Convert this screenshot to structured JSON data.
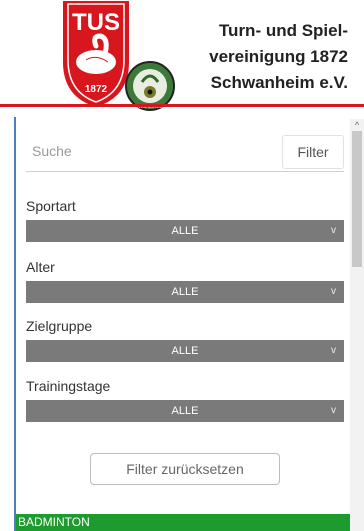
{
  "header": {
    "logo": {
      "tus_text": "TUS",
      "year": "1872",
      "badge_text": "SCHÜTZEN SCHWANHEIM"
    },
    "club_name_lines": [
      "Turn- und Spiel-",
      "vereinigung 1872",
      "Schwanheim e.V."
    ]
  },
  "search": {
    "placeholder": "Suche",
    "filter_button": "Filter"
  },
  "filters": [
    {
      "label": "Sportart",
      "value": "ALLE"
    },
    {
      "label": "Alter",
      "value": "ALLE"
    },
    {
      "label": "Zielgruppe",
      "value": "ALLE"
    },
    {
      "label": "Trainingstage",
      "value": "ALLE"
    }
  ],
  "chevron": "v",
  "reset_button": "Filter zurücksetzen",
  "category": "BADMINTON",
  "colors": {
    "brand_red": "#d7161d",
    "select_gray": "#7a7a7a",
    "category_green": "#1d9b2e",
    "panel_border": "#4a7fc0"
  }
}
